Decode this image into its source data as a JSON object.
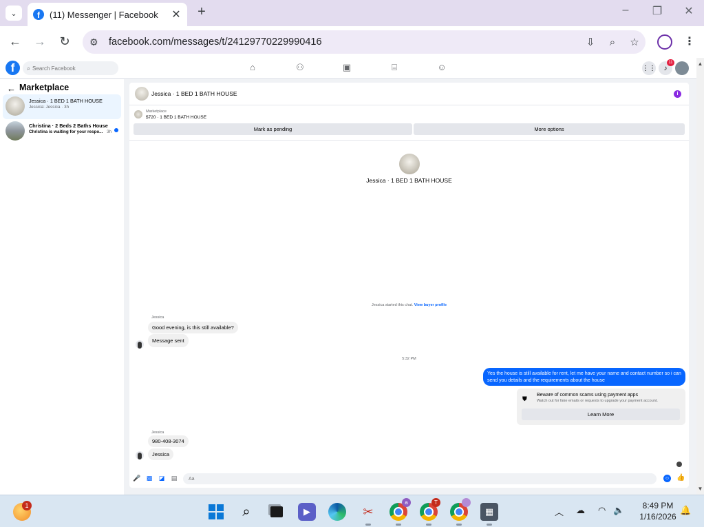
{
  "browser": {
    "tab_title": "(11) Messenger | Facebook",
    "favicon_letter": "f",
    "tab_dropdown_glyph": "⌄",
    "new_tab_glyph": "+",
    "close_glyph": "✕",
    "url": "facebook.com/messages/t/24129770229990416"
  },
  "facebook": {
    "logo_letter": "f",
    "search_placeholder": "Search Facebook",
    "notification_count": "11"
  },
  "sidebar": {
    "title": "Marketplace",
    "back_glyph": "←",
    "conversations": [
      {
        "name": "Jessica · 1 BED 1 BATH HOUSE",
        "snippet": "Jessica: Jessica · 3h"
      },
      {
        "name": "Christina · 2 Beds 2 Baths House",
        "snippet": "Christina is waiting for your respo...",
        "time": "3h"
      }
    ]
  },
  "chat": {
    "title": "Jessica · 1 BED 1 BATH HOUSE",
    "info_glyph": "i",
    "listing": {
      "source": "Marketplace",
      "price_title": "$720 · 1 BED 1 BATH HOUSE",
      "mark_pending": "Mark as pending",
      "more_options": "More options"
    },
    "intro_title": "Jessica · 1 BED 1 BATH HOUSE",
    "started_text": "Jessica started this chat.",
    "view_profile": "View buyer profile",
    "messages": {
      "sender1": "Jessica",
      "msg1": "Good evening, is this still available?",
      "msg2": "Message sent",
      "timestamp": "5:32 PM",
      "outgoing": "Yes the house is still available for rent, let me have your name and  contact number so i can send you details and the requirements about the house",
      "sender2": "Jessica",
      "msg3": "980-408-3074",
      "msg4": "Jessica"
    },
    "scam_warning": {
      "title": "Beware of common scams using payment apps",
      "desc": "Watch out for fake emails or requests to upgrade your payment account.",
      "button": "Learn More"
    },
    "composer_placeholder": "Aa"
  },
  "taskbar": {
    "weather_badge": "1",
    "chrome_badges": [
      "a",
      "T",
      ""
    ],
    "time": "8:49 PM",
    "date": "1/16/2026"
  },
  "colors": {
    "fb_blue": "#0866ff",
    "tab_bar": "#e3dcef",
    "notification": "#e41e3f"
  }
}
